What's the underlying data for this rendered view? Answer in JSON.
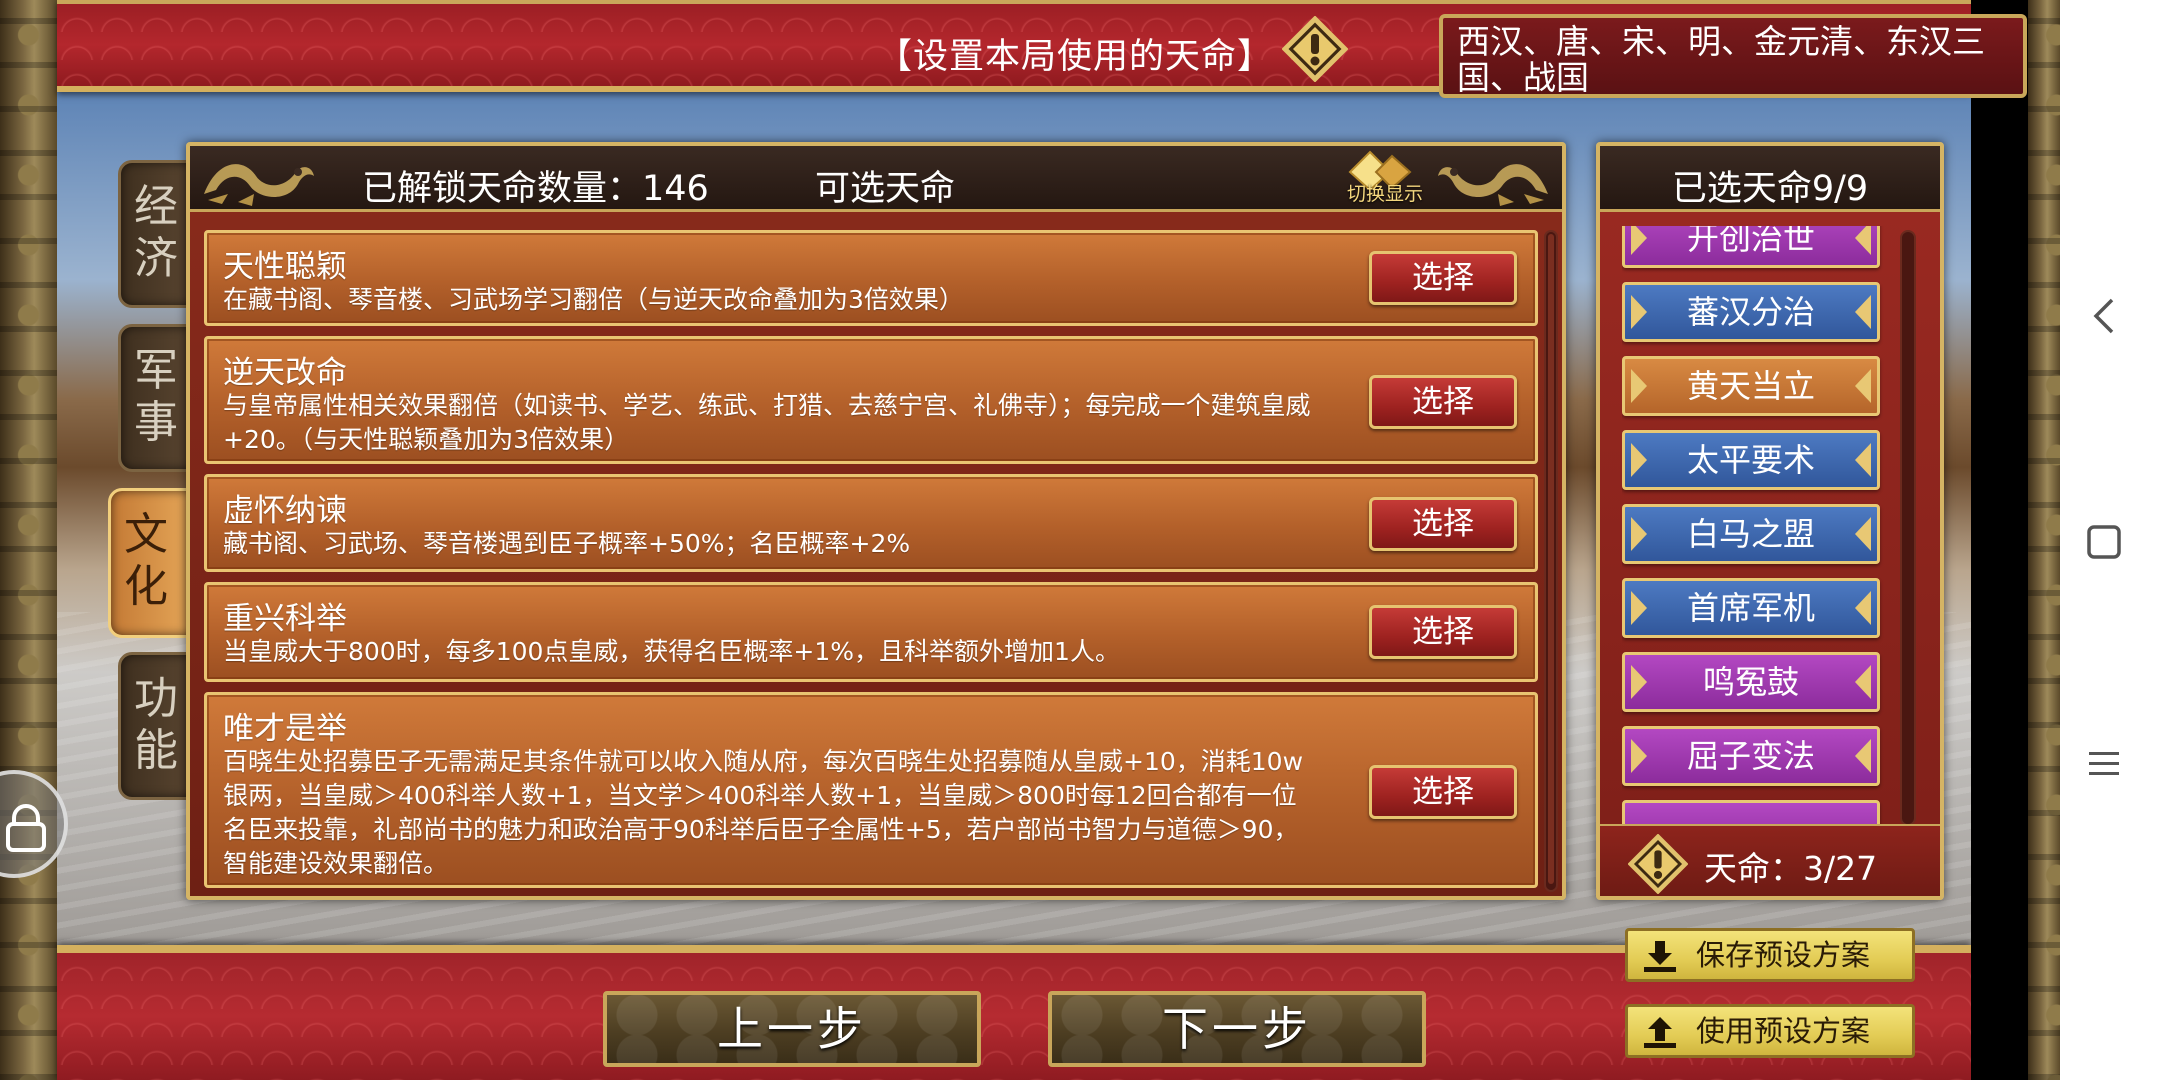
{
  "top": {
    "title": "【设置本局使用的天命】",
    "dynasties": "西汉、唐、宋、明、金元清、东汉三国、战国"
  },
  "tabs": [
    {
      "label": "经济"
    },
    {
      "label": "军事"
    },
    {
      "label": "文化",
      "active": true
    },
    {
      "label": "功能"
    }
  ],
  "main_panel": {
    "unlock_count": "已解锁天命数量：146",
    "title": "可选天命",
    "toggle_label": "切换显示",
    "select_label": "选择",
    "cards": [
      {
        "title": "天性聪颖",
        "desc": "在藏书阁、琴音楼、习武场学习翻倍（与逆天改命叠加为3倍效果）"
      },
      {
        "title": "逆天改命",
        "desc": "与皇帝属性相关效果翻倍（如读书、学艺、练武、打猎、去慈宁宫、礼佛寺）；每完成一个建筑皇威+20。（与天性聪颖叠加为3倍效果）"
      },
      {
        "title": "虚怀纳谏",
        "desc": "藏书阁、习武场、琴音楼遇到臣子概率+50%；名臣概率+2%"
      },
      {
        "title": "重兴科举",
        "desc": "当皇威大于800时，每多100点皇威，获得名臣概率+1%，且科举额外增加1人。"
      },
      {
        "title": "唯才是举",
        "desc": "百晓生处招募臣子无需满足其条件就可以收入随从府，每次百晓生处招募随从皇威+10，消耗10w银两，当皇威＞400科举人数+1，当文学＞400科举人数+1，当皇威＞800时每12回合都有一位名臣来投靠，礼部尚书的魅力和政治高于90科举后臣子全属性+5，若户部尚书智力与道德＞90，智能建设效果翻倍。"
      }
    ]
  },
  "right_panel": {
    "title": "已选天命9/9",
    "items": [
      {
        "label": "开创治世",
        "color": "purple"
      },
      {
        "label": "蕃汉分治",
        "color": "blue"
      },
      {
        "label": "黄天当立",
        "color": "orange"
      },
      {
        "label": "太平要术",
        "color": "blue"
      },
      {
        "label": "白马之盟",
        "color": "blue"
      },
      {
        "label": "首席军机",
        "color": "blue"
      },
      {
        "label": "鸣冤鼓",
        "color": "purple"
      },
      {
        "label": "屈子变法",
        "color": "purple"
      }
    ],
    "fate_count": "天命：3/27"
  },
  "bottom": {
    "prev": "上一步",
    "next": "下一步",
    "save_preset": "保存预设方案",
    "use_preset": "使用预设方案"
  },
  "colors": {
    "accent_gold": "#d5b464",
    "banner_red": "#b4272d",
    "card_orange": "#c06c32",
    "select_red": "#9e2220",
    "preset_yellow": "#e3cc55"
  }
}
